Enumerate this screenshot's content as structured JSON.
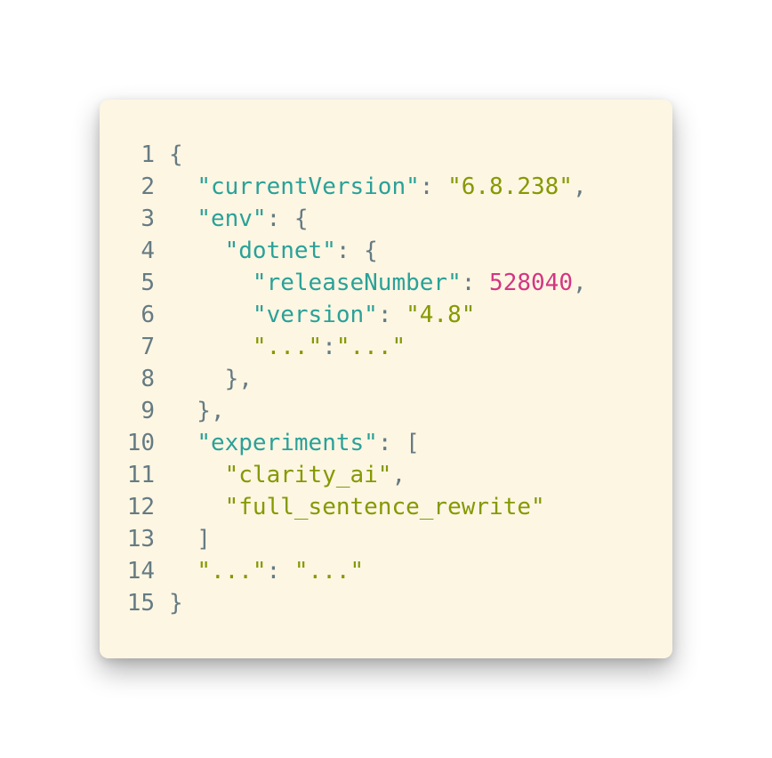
{
  "colors": {
    "background": "#fdf6e3",
    "key": "#2aa198",
    "string": "#859900",
    "number": "#d33682",
    "punctuation": "#657b83"
  },
  "lines": [
    {
      "number": "1",
      "tokens": [
        {
          "t": "p",
          "v": "{"
        }
      ]
    },
    {
      "number": "2",
      "tokens": [
        {
          "t": "p",
          "v": "  "
        },
        {
          "t": "k",
          "v": "\"currentVersion\""
        },
        {
          "t": "p",
          "v": ": "
        },
        {
          "t": "s",
          "v": "\"6.8.238\""
        },
        {
          "t": "p",
          "v": ","
        }
      ]
    },
    {
      "number": "3",
      "tokens": [
        {
          "t": "p",
          "v": "  "
        },
        {
          "t": "k",
          "v": "\"env\""
        },
        {
          "t": "p",
          "v": ": {"
        }
      ]
    },
    {
      "number": "4",
      "tokens": [
        {
          "t": "p",
          "v": "    "
        },
        {
          "t": "k",
          "v": "\"dotnet\""
        },
        {
          "t": "p",
          "v": ": {"
        }
      ]
    },
    {
      "number": "5",
      "tokens": [
        {
          "t": "p",
          "v": "      "
        },
        {
          "t": "k",
          "v": "\"releaseNumber\""
        },
        {
          "t": "p",
          "v": ": "
        },
        {
          "t": "n",
          "v": "528040"
        },
        {
          "t": "p",
          "v": ","
        }
      ]
    },
    {
      "number": "6",
      "tokens": [
        {
          "t": "p",
          "v": "      "
        },
        {
          "t": "k",
          "v": "\"version\""
        },
        {
          "t": "p",
          "v": ": "
        },
        {
          "t": "s",
          "v": "\"4.8\""
        }
      ]
    },
    {
      "number": "7",
      "tokens": [
        {
          "t": "p",
          "v": "      "
        },
        {
          "t": "s",
          "v": "\"...\""
        },
        {
          "t": "p",
          "v": ":"
        },
        {
          "t": "s",
          "v": "\"...\""
        }
      ]
    },
    {
      "number": "8",
      "tokens": [
        {
          "t": "p",
          "v": "    },"
        }
      ]
    },
    {
      "number": "9",
      "tokens": [
        {
          "t": "p",
          "v": "  },"
        }
      ]
    },
    {
      "number": "10",
      "tokens": [
        {
          "t": "p",
          "v": "  "
        },
        {
          "t": "k",
          "v": "\"experiments\""
        },
        {
          "t": "p",
          "v": ": ["
        }
      ]
    },
    {
      "number": "11",
      "tokens": [
        {
          "t": "p",
          "v": "    "
        },
        {
          "t": "s",
          "v": "\"clarity_ai\""
        },
        {
          "t": "p",
          "v": ","
        }
      ]
    },
    {
      "number": "12",
      "tokens": [
        {
          "t": "p",
          "v": "    "
        },
        {
          "t": "s",
          "v": "\"full_sentence_rewrite\""
        }
      ]
    },
    {
      "number": "13",
      "tokens": [
        {
          "t": "p",
          "v": "  ]"
        }
      ]
    },
    {
      "number": "14",
      "tokens": [
        {
          "t": "p",
          "v": "  "
        },
        {
          "t": "s",
          "v": "\"...\""
        },
        {
          "t": "p",
          "v": ": "
        },
        {
          "t": "s",
          "v": "\"...\""
        }
      ]
    },
    {
      "number": "15",
      "tokens": [
        {
          "t": "p",
          "v": "}"
        }
      ]
    }
  ]
}
